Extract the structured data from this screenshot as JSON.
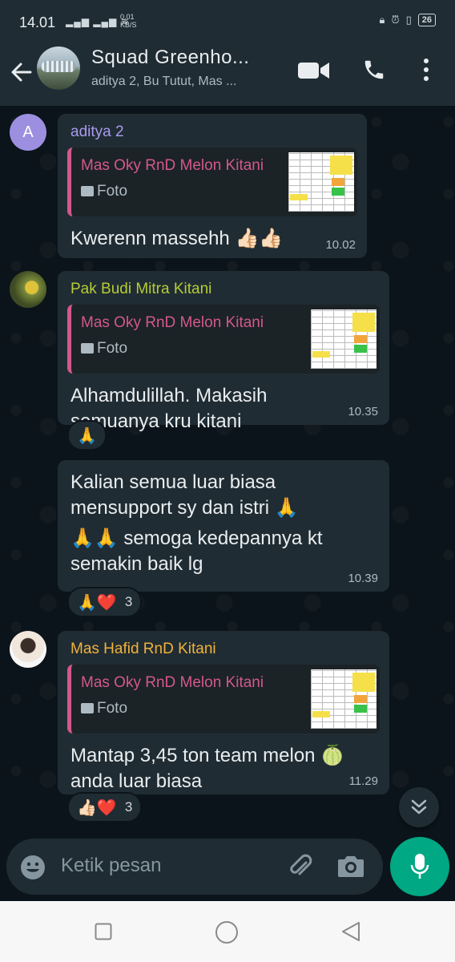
{
  "status_bar": {
    "time": "14.01",
    "network_speed_value": "0.01",
    "network_speed_unit": "KB/S",
    "battery": "26"
  },
  "header": {
    "title": "Squad Greenho...",
    "subtitle": "aditya 2, Bu Tutut, Mas ..."
  },
  "messages": [
    {
      "avatar_letter": "A",
      "sender": "aditya 2",
      "sender_color": "#a99bf0",
      "quote_author": "Mas Oky RnD Melon Kitani",
      "quote_type": "Foto",
      "text": "Kwerenn massehh 👍🏻👍🏻",
      "time": "10.02"
    },
    {
      "sender": "Pak Budi Mitra Kitani",
      "sender_color": "#b5cc36",
      "quote_author": "Mas Oky RnD Melon Kitani",
      "quote_type": "Foto",
      "text": "Alhamdulillah. Makasih semuanya kru kitani",
      "time": "10.35",
      "reaction": "🙏"
    },
    {
      "text_line1": "Kalian semua luar biasa mensupport sy dan istri 🙏",
      "text_line2": "🙏🙏 semoga kedepannya kt semakin baik lg",
      "time": "10.39",
      "reaction": "🙏❤️",
      "reaction_count": "3"
    },
    {
      "sender": "Mas Hafid RnD Kitani",
      "sender_color": "#f0b23a",
      "quote_author": "Mas Oky RnD Melon Kitani",
      "quote_type": "Foto",
      "text": "Mantap 3,45 ton team melon 🍈 anda luar biasa",
      "time": "11.29",
      "reaction": "👍🏻❤️",
      "reaction_count": "3"
    }
  ],
  "input": {
    "placeholder": "Ketik pesan"
  },
  "colors": {
    "accent": "#00a884",
    "quote_bar": "#d4588a",
    "bubble": "#202c33",
    "background": "#0b141a"
  }
}
